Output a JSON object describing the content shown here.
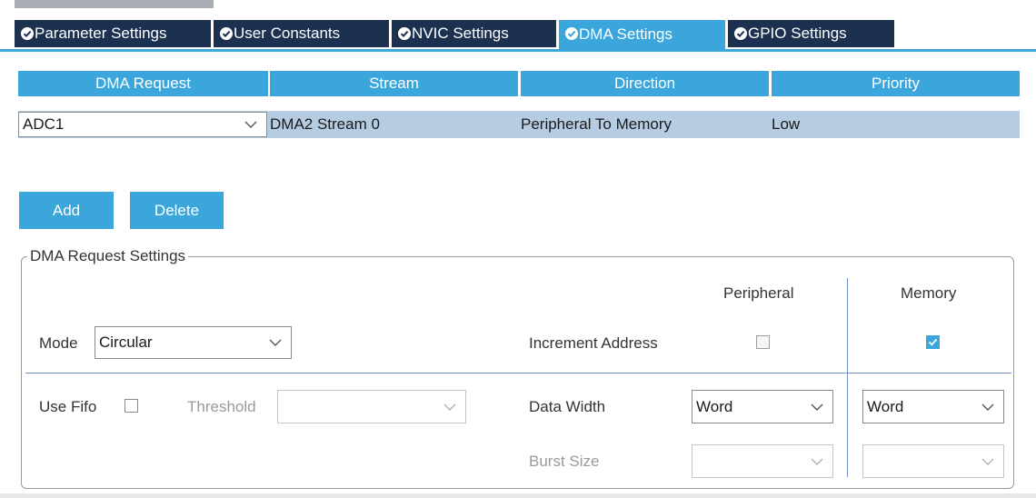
{
  "tabs": [
    {
      "label": "Parameter Settings",
      "active": false
    },
    {
      "label": "User Constants",
      "active": false
    },
    {
      "label": "NVIC Settings",
      "active": false
    },
    {
      "label": "DMA Settings",
      "active": true
    },
    {
      "label": "GPIO Settings",
      "active": false
    }
  ],
  "table": {
    "headers": [
      "DMA Request",
      "Stream",
      "Direction",
      "Priority"
    ],
    "rows": [
      {
        "request": "ADC1",
        "stream": "DMA2 Stream 0",
        "direction": "Peripheral To Memory",
        "priority": "Low"
      }
    ]
  },
  "buttons": {
    "add": "Add",
    "delete": "Delete"
  },
  "settings": {
    "legend": "DMA Request Settings",
    "peripheral_header": "Peripheral",
    "memory_header": "Memory",
    "mode_label": "Mode",
    "mode_value": "Circular",
    "increment_label": "Increment Address",
    "increment_peripheral": false,
    "increment_memory": true,
    "use_fifo_label": "Use Fifo",
    "use_fifo": false,
    "threshold_label": "Threshold",
    "threshold_value": "",
    "data_width_label": "Data Width",
    "data_width_peripheral": "Word",
    "data_width_memory": "Word",
    "burst_size_label": "Burst Size",
    "burst_peripheral": "",
    "burst_memory": ""
  },
  "colors": {
    "accent": "#3aa6dc",
    "tab_dark": "#1c3150",
    "row_selected": "#b6cce3"
  },
  "icons": {
    "tab": "check-circle-icon",
    "dropdown": "chevron-down-icon",
    "checkbox_checked": "checkmark-icon"
  }
}
